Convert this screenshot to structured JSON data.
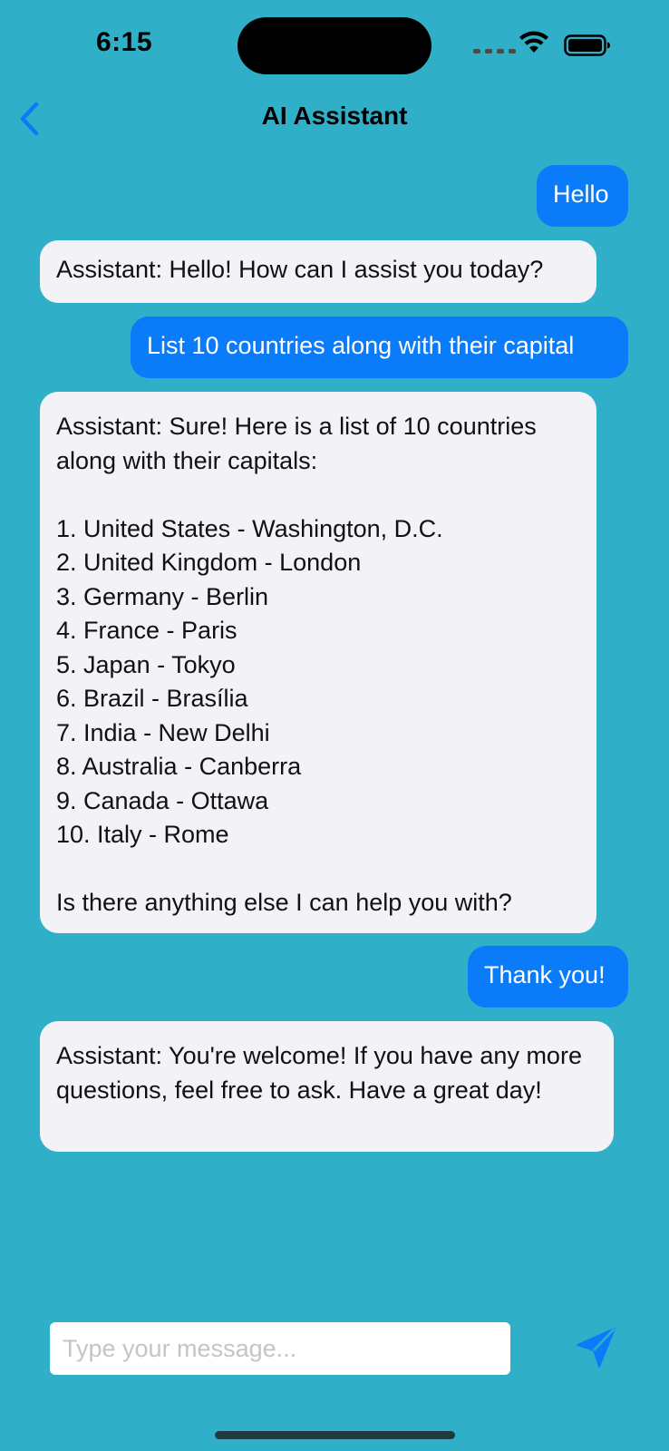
{
  "status_bar": {
    "time": "6:15",
    "icons": [
      "cellular-signal-icon",
      "wifi-icon",
      "battery-icon"
    ]
  },
  "nav": {
    "back_icon": "chevron-left-icon",
    "title": "AI Assistant"
  },
  "messages": [
    {
      "sender": "user",
      "text": "Hello"
    },
    {
      "sender": "assistant",
      "text": "Assistant: Hello! How can I assist you today?"
    },
    {
      "sender": "user",
      "text": "List 10 countries along with their capital"
    },
    {
      "sender": "assistant",
      "text": "Assistant: Sure! Here is a list of 10 countries along with their capitals:\n\n1. United States - Washington, D.C.\n2. United Kingdom - London\n3. Germany - Berlin\n4. France - Paris\n5. Japan - Tokyo\n6. Brazil - Brasília\n7. India - New Delhi\n8. Australia - Canberra\n9. Canada - Ottawa\n10. Italy - Rome\n\nIs there anything else I can help you with?"
    },
    {
      "sender": "user",
      "text": "Thank you!"
    },
    {
      "sender": "assistant",
      "text": "Assistant: You're welcome! If you have any more questions, feel free to ask. Have a great day!"
    }
  ],
  "composer": {
    "value": "",
    "placeholder": "Type your message...",
    "send_icon": "paper-plane-icon"
  },
  "colors": {
    "background": "#2fafc8",
    "user_bubble": "#0a7cfa",
    "assistant_bubble": "#f2f2f7",
    "accent": "#0a7cfa"
  }
}
